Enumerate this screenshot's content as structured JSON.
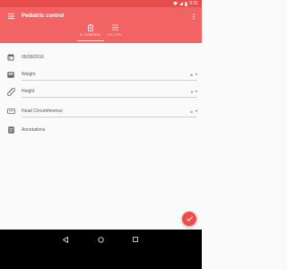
{
  "status_bar": {
    "time": "9:31",
    "icons": [
      "signal-icon",
      "wifi-icon",
      "battery-icon"
    ],
    "color": "#e84d4d"
  },
  "app_bar": {
    "title": "Pediatric control",
    "color": "#f26363",
    "menu_icon": "hamburger-menu-icon",
    "more_icon": "more-vert-icon"
  },
  "tabs": [
    {
      "label": "R. CONTROL",
      "icon": "clipboard-icon",
      "selected": true
    },
    {
      "label": "RECORD",
      "icon": "list-icon",
      "selected": false
    }
  ],
  "form": {
    "date": {
      "icon": "calendar-icon",
      "value": "05/09/2016"
    },
    "weight": {
      "icon": "scale-icon",
      "placeholder": "Weight",
      "unit": "lb"
    },
    "height": {
      "icon": "ruler-icon",
      "placeholder": "Height",
      "unit": "ft"
    },
    "head_circumference": {
      "icon": "head-icon",
      "placeholder": "Head Circumference",
      "unit": "in"
    },
    "annotations": {
      "icon": "notes-icon",
      "placeholder": "Annotations"
    }
  },
  "fab": {
    "icon": "check-icon",
    "color": "#f44a4a"
  },
  "nav_bar": {
    "buttons": [
      "back-icon",
      "home-icon",
      "recents-icon"
    ]
  }
}
